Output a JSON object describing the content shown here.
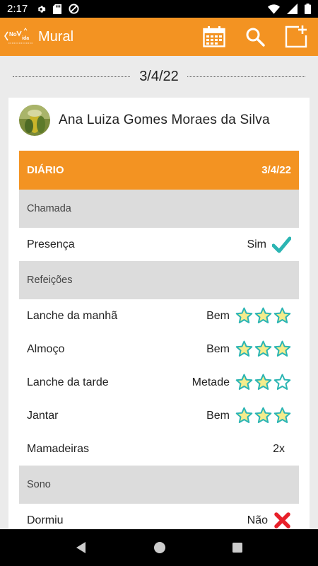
{
  "status_bar": {
    "time": "2:17",
    "icons": [
      "gear-icon",
      "sd-card-icon",
      "no-data-icon",
      "wifi-icon",
      "signal-icon",
      "battery-icon"
    ]
  },
  "app_bar": {
    "title": "Mural",
    "logo_text": "NoVida",
    "actions": [
      "calendar-icon",
      "search-icon",
      "new-post-icon"
    ]
  },
  "feed": {
    "date": "3/4/22"
  },
  "post": {
    "author": "Ana Luiza Gomes Moraes da Silva",
    "diary": {
      "title": "DIÁRIO",
      "date": "3/4/22",
      "sections": [
        {
          "title": "Chamada",
          "rows": [
            {
              "label": "Presença",
              "value": "Sim",
              "indicator": "check"
            }
          ]
        },
        {
          "title": "Refeições",
          "rows": [
            {
              "label": "Lanche da manhã",
              "value": "Bem",
              "rating": 3
            },
            {
              "label": "Almoço",
              "value": "Bem",
              "rating": 3
            },
            {
              "label": "Lanche da tarde",
              "value": "Metade",
              "rating": 2
            },
            {
              "label": "Jantar",
              "value": "Bem",
              "rating": 3
            },
            {
              "label": "Mamadeiras",
              "value": "2x"
            }
          ]
        },
        {
          "title": "Sono",
          "rows": [
            {
              "label": "Dormiu",
              "value": "Não",
              "indicator": "cross"
            }
          ]
        }
      ]
    }
  },
  "colors": {
    "brand": "#f39322",
    "check": "#2bb5b3",
    "cross": "#e8202a",
    "star_fill": "#f4ec8c",
    "star_stroke": "#2bb5b3"
  }
}
